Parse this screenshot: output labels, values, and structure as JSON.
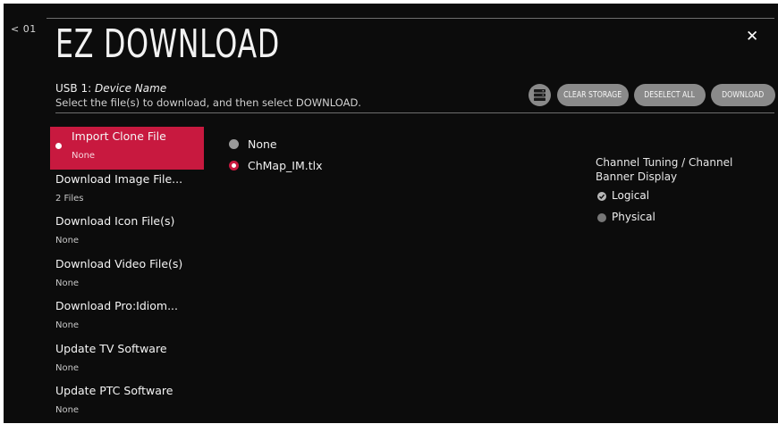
{
  "nav": {
    "back_label": "< 01"
  },
  "header": {
    "title": "EZ DOWNLOAD",
    "usb_prefix": "USB 1: ",
    "device_name": "Device Name",
    "instruction": "Select the file(s) to download, and then select DOWNLOAD.",
    "close_icon": "close-icon",
    "storage_icon": "storage-icon"
  },
  "toolbar": {
    "clear_storage": "CLEAR STORAGE",
    "deselect_all": "DESELECT ALL",
    "download": "DOWNLOAD"
  },
  "menu": {
    "items": [
      {
        "label": "Import Clone File",
        "sub": "None",
        "active": true
      },
      {
        "label": "Download Image File...",
        "sub": "2 Files"
      },
      {
        "label": "Download Icon File(s)",
        "sub": "None"
      },
      {
        "label": "Download Video File(s)",
        "sub": "None"
      },
      {
        "label": "Download Pro:Idiom...",
        "sub": "None"
      },
      {
        "label": "Update TV Software",
        "sub": "None"
      },
      {
        "label": "Update PTC Software",
        "sub": "None"
      }
    ]
  },
  "files": {
    "options": [
      {
        "label": "None",
        "selected": false
      },
      {
        "label": "ChMap_IM.tlx",
        "selected": true
      }
    ]
  },
  "settings": {
    "title": "Channel Tuning / Channel Banner Display",
    "options": [
      {
        "label": "Logical",
        "selected": true
      },
      {
        "label": "Physical",
        "selected": false
      }
    ]
  },
  "colors": {
    "accent": "#c8193f",
    "background": "#0c0c0c",
    "button": "#8a8a8a"
  }
}
